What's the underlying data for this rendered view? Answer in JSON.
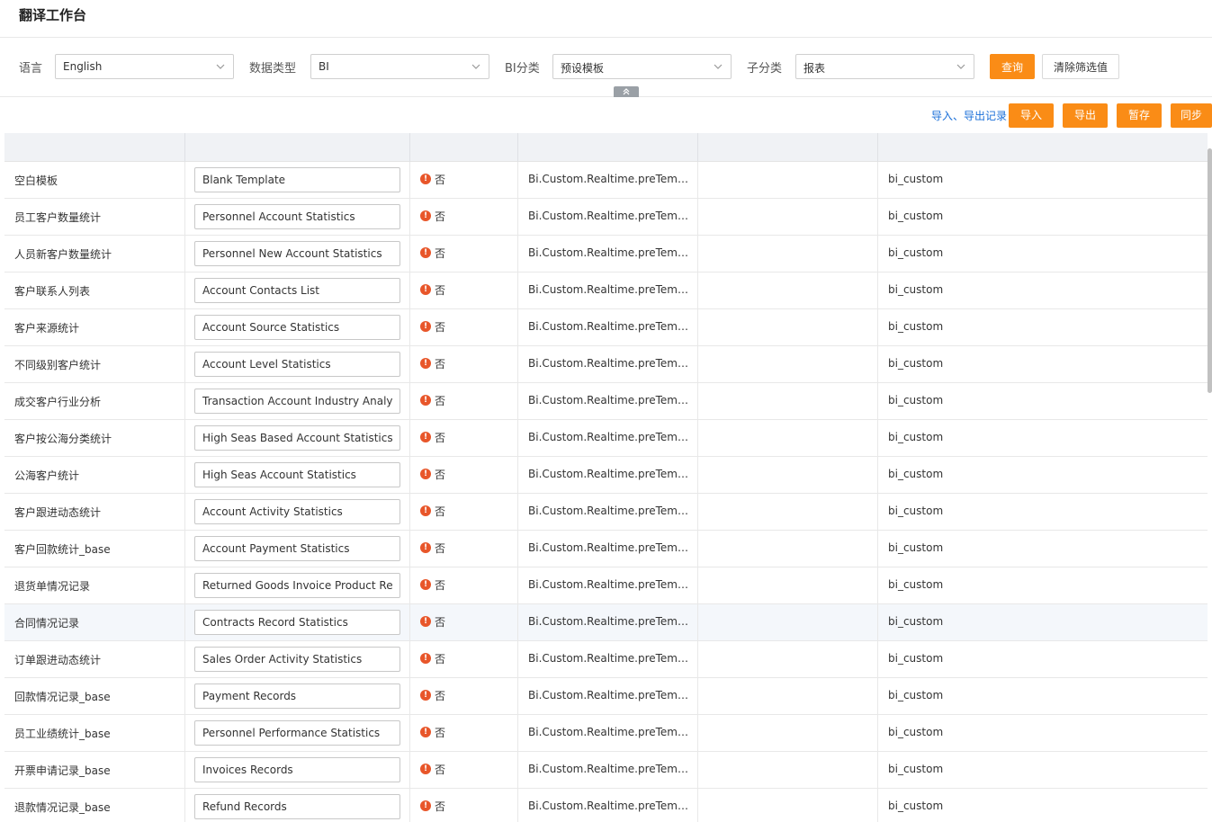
{
  "page": {
    "title": "翻译工作台"
  },
  "filters": {
    "language_label": "语言",
    "language_value": "English",
    "data_type_label": "数据类型",
    "data_type_value": "BI",
    "bi_category_label": "BI分类",
    "bi_category_value": "预设模板",
    "sub_category_label": "子分类",
    "sub_category_value": "报表",
    "query_button": "查询",
    "clear_button": "清除筛选值"
  },
  "actions": {
    "records_link": "导入、导出记录",
    "import_button": "导入",
    "export_button": "导出",
    "save_button": "暂存",
    "sync_button": "同步"
  },
  "colors": {
    "accent": "#fa8c16",
    "link": "#1a6fd8",
    "warning": "#e8562a",
    "header_bg": "#f0f2f5"
  },
  "table": {
    "status_icon": "exclamation-circle-icon",
    "rows": [
      {
        "source": "空白模板",
        "translation": "Blank Template",
        "status": "否",
        "key": "Bi.Custom.Realtime.preTempla...",
        "note": "",
        "module": "bi_custom"
      },
      {
        "source": "员工客户数量统计",
        "translation": "Personnel Account Statistics",
        "status": "否",
        "key": "Bi.Custom.Realtime.preTempla...",
        "note": "",
        "module": "bi_custom"
      },
      {
        "source": "人员新客户数量统计",
        "translation": "Personnel New Account Statistics",
        "status": "否",
        "key": "Bi.Custom.Realtime.preTempla...",
        "note": "",
        "module": "bi_custom"
      },
      {
        "source": "客户联系人列表",
        "translation": "Account Contacts List",
        "status": "否",
        "key": "Bi.Custom.Realtime.preTempla...",
        "note": "",
        "module": "bi_custom"
      },
      {
        "source": "客户来源统计",
        "translation": "Account Source Statistics",
        "status": "否",
        "key": "Bi.Custom.Realtime.preTempla...",
        "note": "",
        "module": "bi_custom"
      },
      {
        "source": "不同级别客户统计",
        "translation": "Account Level Statistics",
        "status": "否",
        "key": "Bi.Custom.Realtime.preTempla...",
        "note": "",
        "module": "bi_custom"
      },
      {
        "source": "成交客户行业分析",
        "translation": "Transaction Account Industry Analys",
        "status": "否",
        "key": "Bi.Custom.Realtime.preTempla...",
        "note": "",
        "module": "bi_custom"
      },
      {
        "source": "客户按公海分类统计",
        "translation": "High Seas Based Account Statistics",
        "status": "否",
        "key": "Bi.Custom.Realtime.preTempla...",
        "note": "",
        "module": "bi_custom"
      },
      {
        "source": "公海客户统计",
        "translation": "High Seas Account Statistics",
        "status": "否",
        "key": "Bi.Custom.Realtime.preTempla...",
        "note": "",
        "module": "bi_custom"
      },
      {
        "source": "客户跟进动态统计",
        "translation": "Account Activity Statistics",
        "status": "否",
        "key": "Bi.Custom.Realtime.preTempla...",
        "note": "",
        "module": "bi_custom"
      },
      {
        "source": "客户回款统计_base",
        "translation": "Account Payment Statistics",
        "status": "否",
        "key": "Bi.Custom.Realtime.preTempla...",
        "note": "",
        "module": "bi_custom"
      },
      {
        "source": "退货单情况记录",
        "translation": "Returned Goods Invoice Product Re",
        "status": "否",
        "key": "Bi.Custom.Realtime.preTempla...",
        "note": "",
        "module": "bi_custom"
      },
      {
        "source": "合同情况记录",
        "translation": "Contracts Record Statistics",
        "status": "否",
        "key": "Bi.Custom.Realtime.preTempla...",
        "note": "",
        "module": "bi_custom"
      },
      {
        "source": "订单跟进动态统计",
        "translation": "Sales Order Activity Statistics",
        "status": "否",
        "key": "Bi.Custom.Realtime.preTempla...",
        "note": "",
        "module": "bi_custom"
      },
      {
        "source": "回款情况记录_base",
        "translation": "Payment Records",
        "status": "否",
        "key": "Bi.Custom.Realtime.preTempla...",
        "note": "",
        "module": "bi_custom"
      },
      {
        "source": "员工业绩统计_base",
        "translation": "Personnel Performance Statistics",
        "status": "否",
        "key": "Bi.Custom.Realtime.preTempla...",
        "note": "",
        "module": "bi_custom"
      },
      {
        "source": "开票申请记录_base",
        "translation": "Invoices Records",
        "status": "否",
        "key": "Bi.Custom.Realtime.preTempla...",
        "note": "",
        "module": "bi_custom"
      },
      {
        "source": "退款情况记录_base",
        "translation": "Refund Records",
        "status": "否",
        "key": "Bi.Custom.Realtime.preTempla...",
        "note": "",
        "module": "bi_custom"
      }
    ]
  }
}
